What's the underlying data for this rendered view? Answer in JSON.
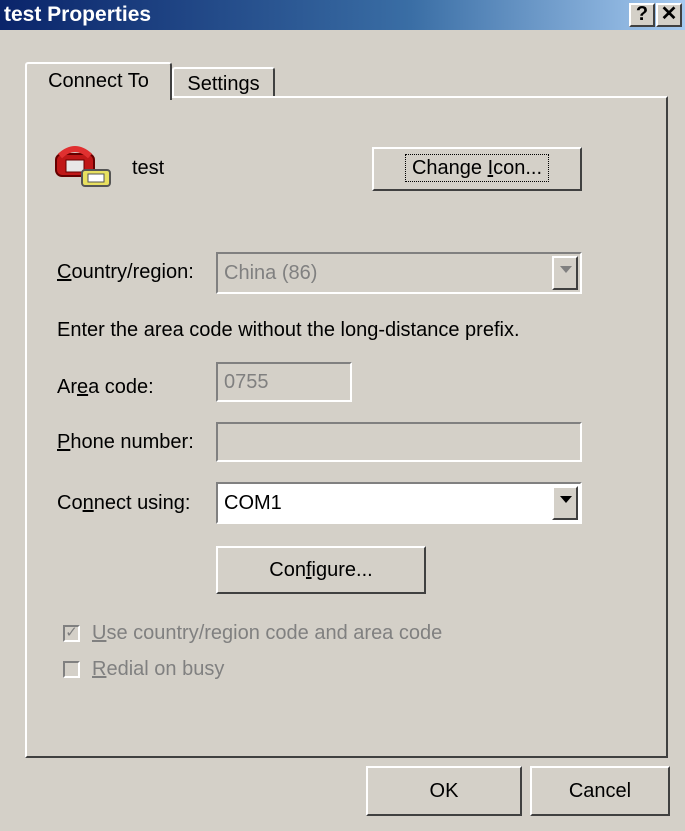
{
  "window": {
    "title": "test Properties",
    "help_glyph": "?",
    "close_glyph": "✕"
  },
  "tabs": [
    {
      "label": "Connect To",
      "active": true
    },
    {
      "label": "Settings",
      "active": false
    }
  ],
  "connection": {
    "name": "test",
    "icon": "phone-connection-icon"
  },
  "buttons": {
    "change_icon": {
      "pre": "Change ",
      "u": "I",
      "post": "con..."
    },
    "configure": {
      "pre": "Con",
      "u": "f",
      "post": "igure..."
    },
    "ok": "OK",
    "cancel": "Cancel"
  },
  "form": {
    "country_label": {
      "u": "C",
      "post": "ountry/region:"
    },
    "country_value": "China (86)",
    "instruction": "Enter the area code without the long-distance prefix.",
    "area_label": {
      "pre": "Ar",
      "u": "e",
      "post": "a code:"
    },
    "area_value": "0755",
    "phone_label": {
      "u": "P",
      "post": "hone number:"
    },
    "phone_value": "",
    "connect_label": {
      "pre": "Co",
      "u": "n",
      "post": "nect using:"
    },
    "connect_value": "COM1"
  },
  "options": {
    "use_codes": {
      "u": "U",
      "post": "se country/region code and area code",
      "checked": true
    },
    "redial": {
      "u": "R",
      "post": "edial on busy",
      "checked": false
    }
  }
}
